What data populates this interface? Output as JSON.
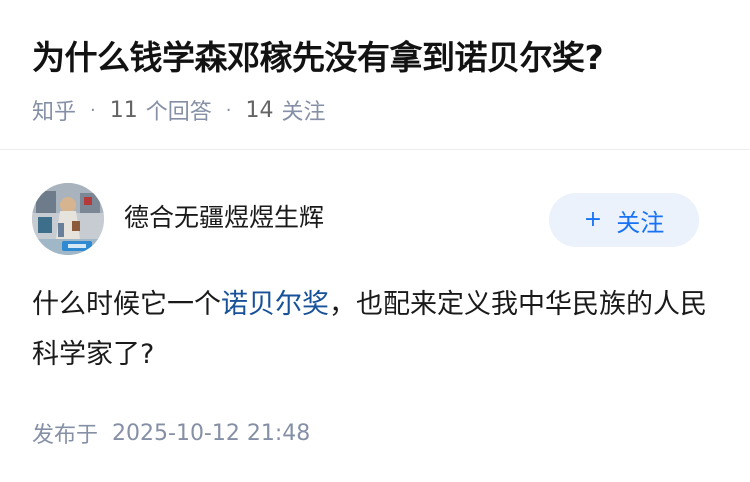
{
  "question": {
    "title": "为什么钱学森邓稼先没有拿到诺贝尔奖?",
    "source": "知乎",
    "answer_count": "11",
    "answer_count_label": "个回答",
    "follow_count": "14",
    "follow_count_label": "关注",
    "separator": "·"
  },
  "answer": {
    "author": {
      "name": "德合无疆煜煜生辉",
      "avatar_icon": "avatar-photo",
      "follow_icon": "plus-icon",
      "follow_label": "关注"
    },
    "content": {
      "before_link": "什么时候它一个",
      "link_text": "诺贝尔奖",
      "after_link": "，也配来定义我中华民族的人民科学家了?"
    },
    "published_label": "发布于",
    "published_time": "2025-10-12 21:48"
  },
  "colors": {
    "title": "#121212",
    "meta": "#8590a6",
    "link": "#175199",
    "follow_text": "#1772f6",
    "follow_bg": "#ebf2fb"
  }
}
